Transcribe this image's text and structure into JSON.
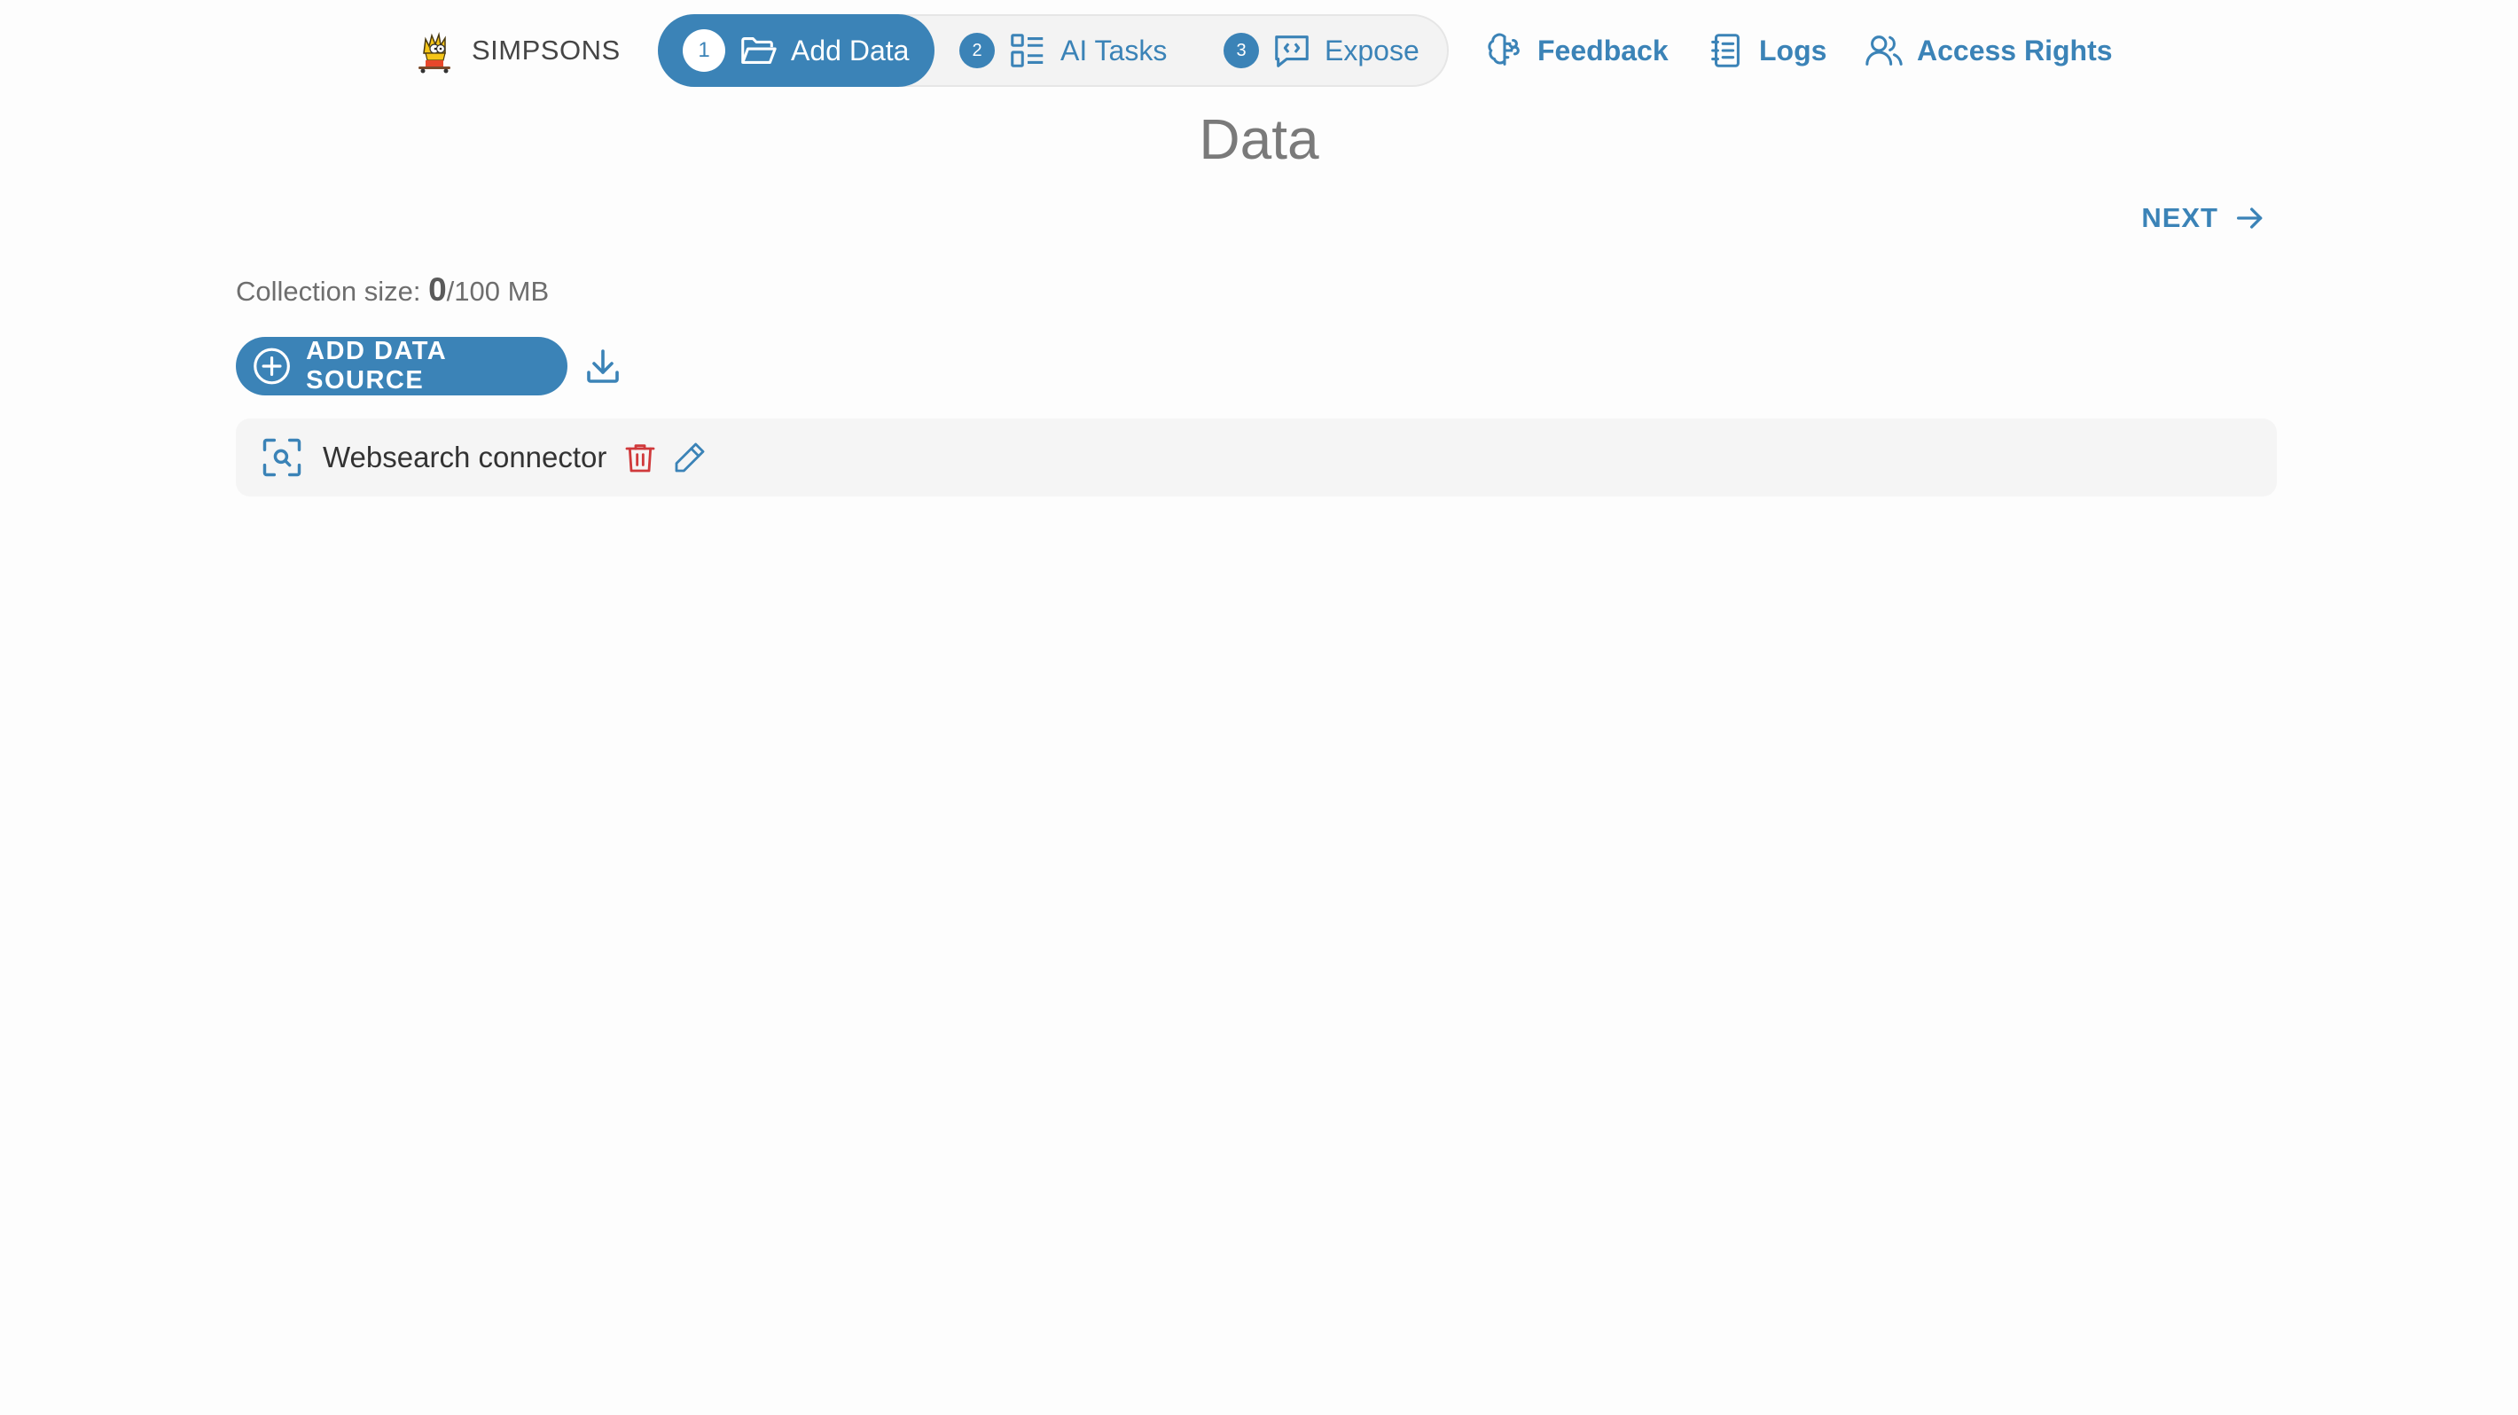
{
  "brand": {
    "name": "SIMPSONS",
    "logo_icon": "bart-simpson-logo"
  },
  "stepper": {
    "steps": [
      {
        "num": "1",
        "label": "Add Data",
        "icon": "folder-open-icon",
        "active": true
      },
      {
        "num": "2",
        "label": "AI Tasks",
        "icon": "list-grid-icon",
        "active": false
      },
      {
        "num": "3",
        "label": "Expose",
        "icon": "chat-code-icon",
        "active": false
      }
    ]
  },
  "nav": {
    "feedback": "Feedback",
    "logs": "Logs",
    "access_rights": "Access Rights"
  },
  "page": {
    "title": "Data",
    "next_label": "NEXT",
    "collection_size_label": "Collection size: ",
    "collection_size_value": "0",
    "collection_size_limit": "/100 MB",
    "add_source_label": "ADD DATA SOURCE"
  },
  "sources": [
    {
      "name": "Websearch connector",
      "icon": "web-search-icon"
    }
  ],
  "colors": {
    "accent": "#3b83b7",
    "delete": "#d0393b",
    "background": "#fdfdfd"
  }
}
